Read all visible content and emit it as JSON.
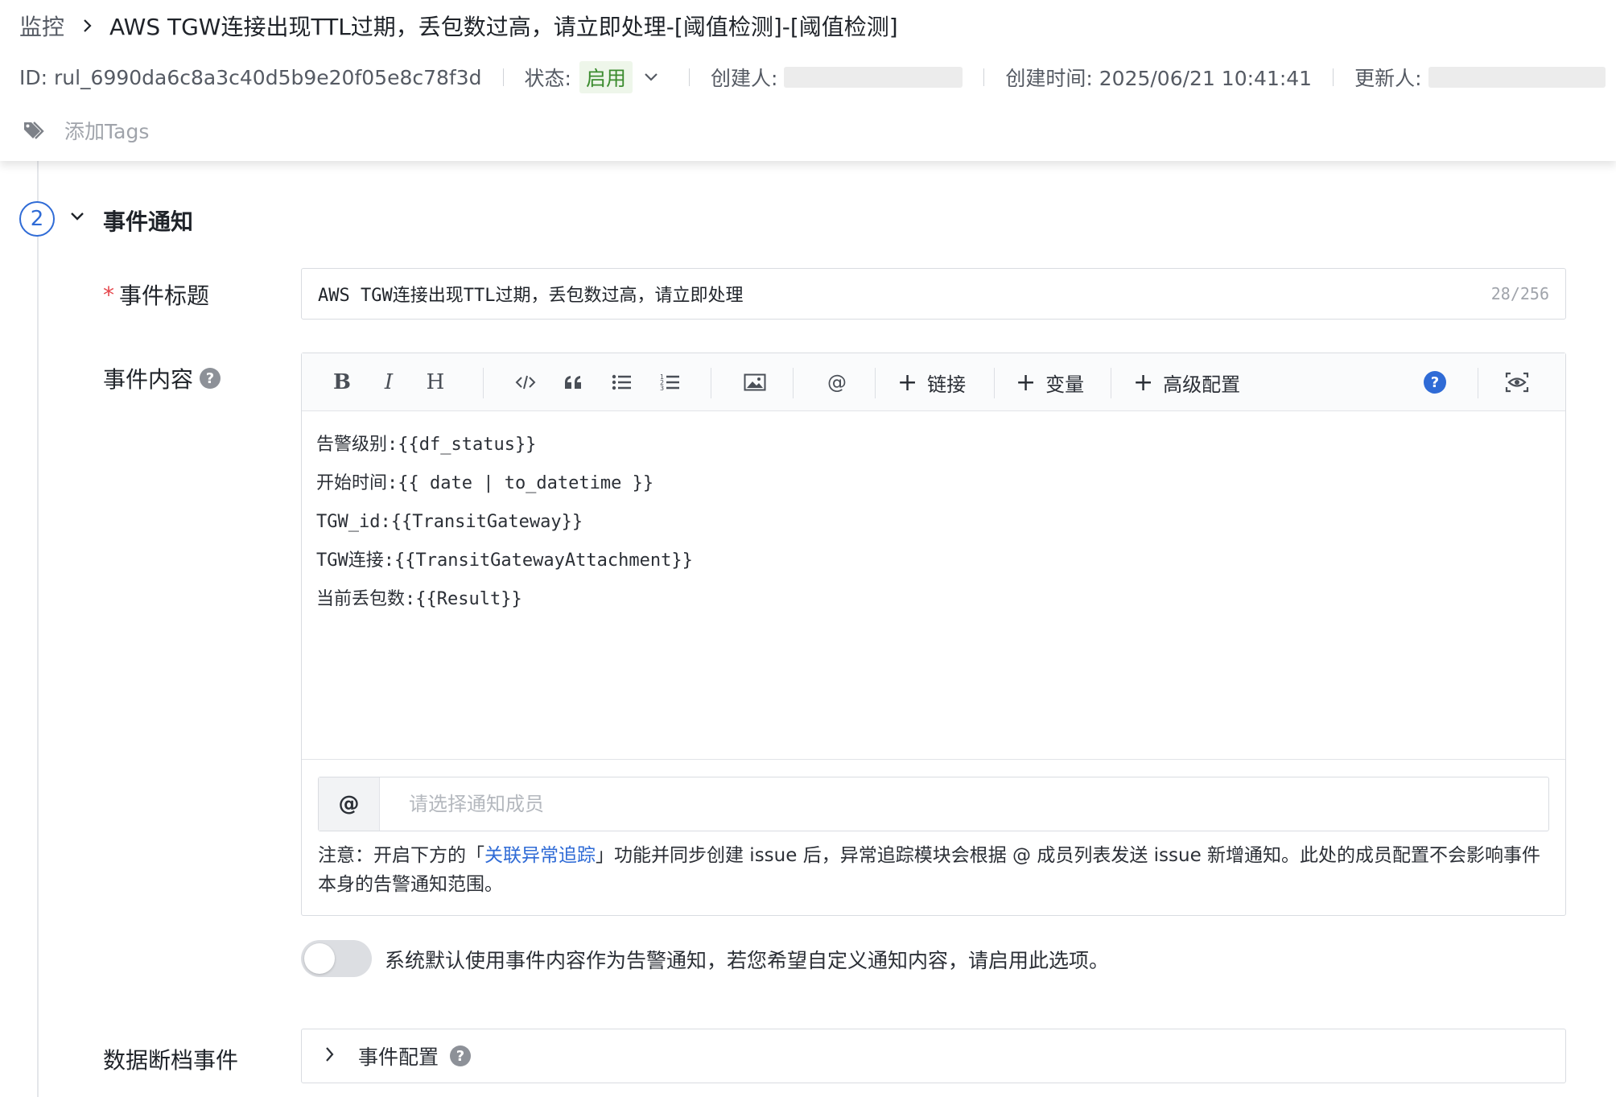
{
  "header": {
    "breadcrumb_root": "监控",
    "title": "AWS TGW连接出现TTL过期，丢包数过高，请立即处理-[阈值检测]-[阈值检测]",
    "id_text": "ID: rul_6990da6c8a3c40d5b9e20f05e8c78f3d",
    "status_label": "状态:",
    "status_value": "启用",
    "creator_label": "创建人:",
    "created_time": "创建时间: 2025/06/21 10:41:41",
    "updater_label": "更新人:",
    "add_tags": "添加Tags"
  },
  "section": {
    "step_number": "2",
    "title": "事件通知"
  },
  "form": {
    "event_title_label": "事件标题",
    "event_title_value": "AWS TGW连接出现TTL过期，丢包数过高，请立即处理",
    "event_title_count": "28/256",
    "event_content_label": "事件内容",
    "help_glyph": "?",
    "toolbar": {
      "bold": "B",
      "italic": "I",
      "heading": "H",
      "link": "链接",
      "variable": "变量",
      "advanced": "高级配置",
      "help_glyph": "?"
    },
    "content_lines": [
      "告警级别:{{df_status}}",
      "开始时间:{{ date | to_datetime }}",
      "TGW_id:{{TransitGateway}}",
      "TGW连接:{{TransitGatewayAttachment}}",
      "当前丢包数:{{Result}}"
    ],
    "at_symbol": "@",
    "member_placeholder": "请选择通知成员",
    "note_prefix": "注意：开启下方的「",
    "note_link": "关联异常追踪",
    "note_suffix": "」功能并同步创建 issue 后，异常追踪模块会根据 @ 成员列表发送 issue 新增通知。此处的成员配置不会影响事件本身的告警通知范围。",
    "custom_notify_text": "系统默认使用事件内容作为告警通知，若您希望自定义通知内容，请启用此选项。",
    "custom_notify_enabled": false,
    "nodata_label": "数据断档事件",
    "event_config": "事件配置"
  },
  "colors": {
    "accent": "#2f6bd6",
    "status_green": "#3c8c2f",
    "required_red": "#e5484d"
  }
}
